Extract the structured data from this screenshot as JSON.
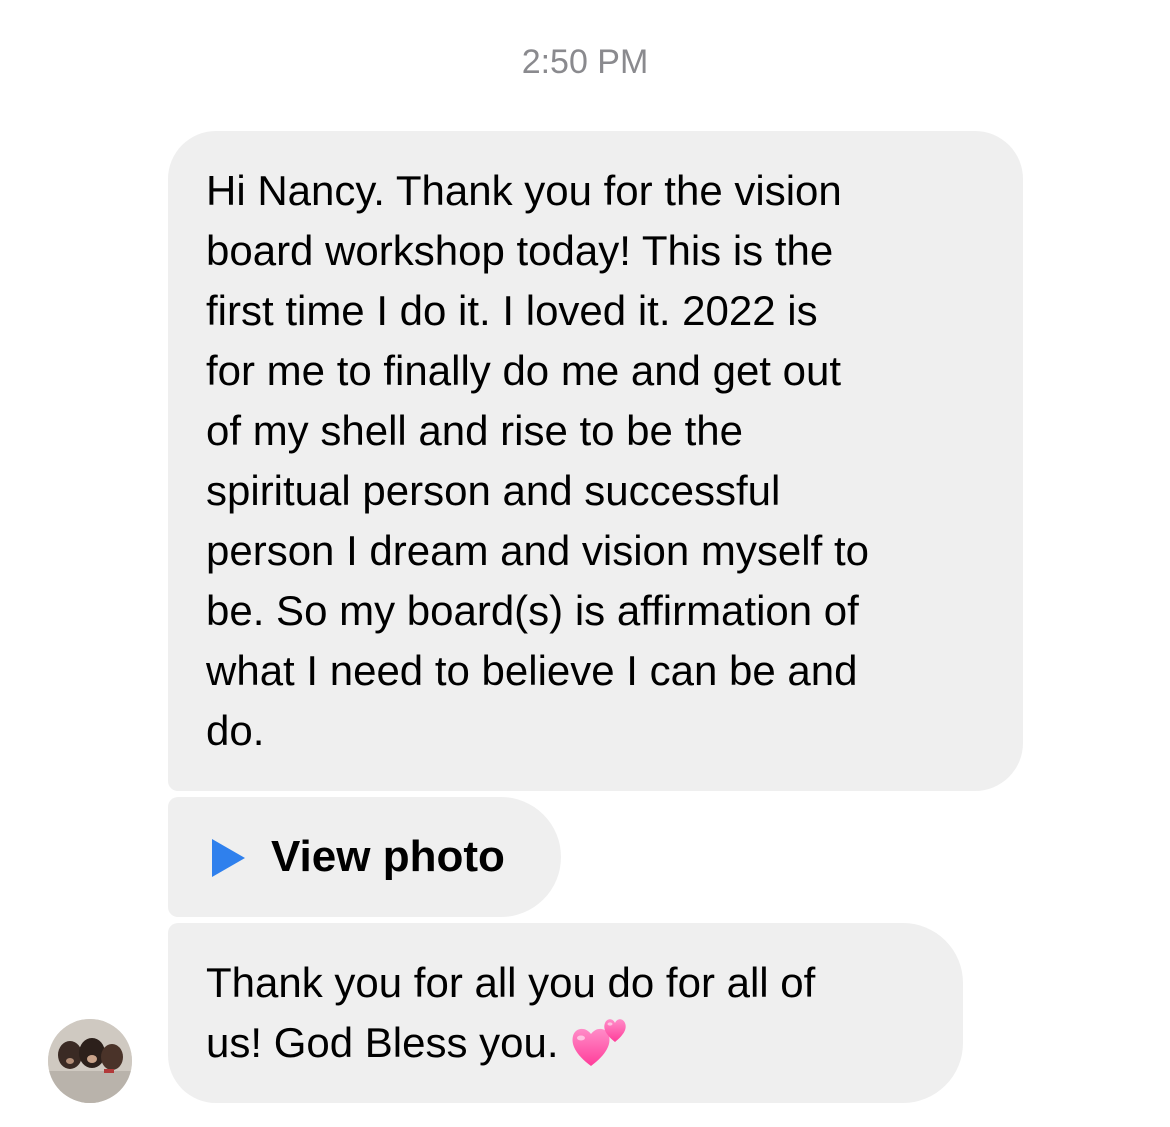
{
  "timestamp": "2:50 PM",
  "messages": [
    {
      "lines": [
        "Hi Nancy. Thank you for the vision",
        "board workshop today!  This is the",
        "first time I do it.  I loved it.  2022 is",
        "for me to finally do me and get out",
        "of my shell and rise to be the",
        "spiritual person and successful",
        "person I dream and vision myself to",
        "be. So my board(s) is affirmation of",
        "what I need to believe I can be and",
        "do."
      ]
    },
    {
      "attachment_label": "View photo",
      "attachment_icon": "play-icon"
    },
    {
      "lines": [
        "Thank you for all you do for all of",
        "us!  God Bless you."
      ],
      "emoji": "two-hearts-icon"
    }
  ],
  "sender_avatar": "avatar-photo",
  "colors": {
    "bubble": "#efefef",
    "timestamp": "#8a8a8e",
    "play_icon": "#2f80ed",
    "heart": "#ff4fa3"
  }
}
